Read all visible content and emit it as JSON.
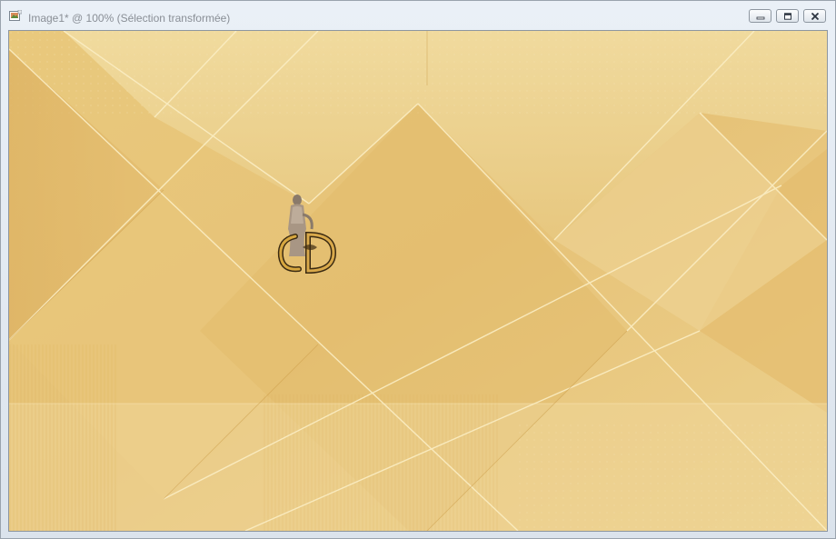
{
  "window": {
    "title": "Image1* @ 100% (Sélection transformée)",
    "minimize_icon": "minimize-icon",
    "restore_icon": "restore-icon",
    "close_icon": "close-icon",
    "app_icon": "image-document-icon"
  },
  "canvas": {
    "background": "golden diamond pattern",
    "colors": {
      "base": "#e8c879",
      "light": "#f0d99a",
      "dark": "#d9ad55",
      "line": "#fbecc0"
    },
    "content_icon": "statue-monogram-logo"
  }
}
